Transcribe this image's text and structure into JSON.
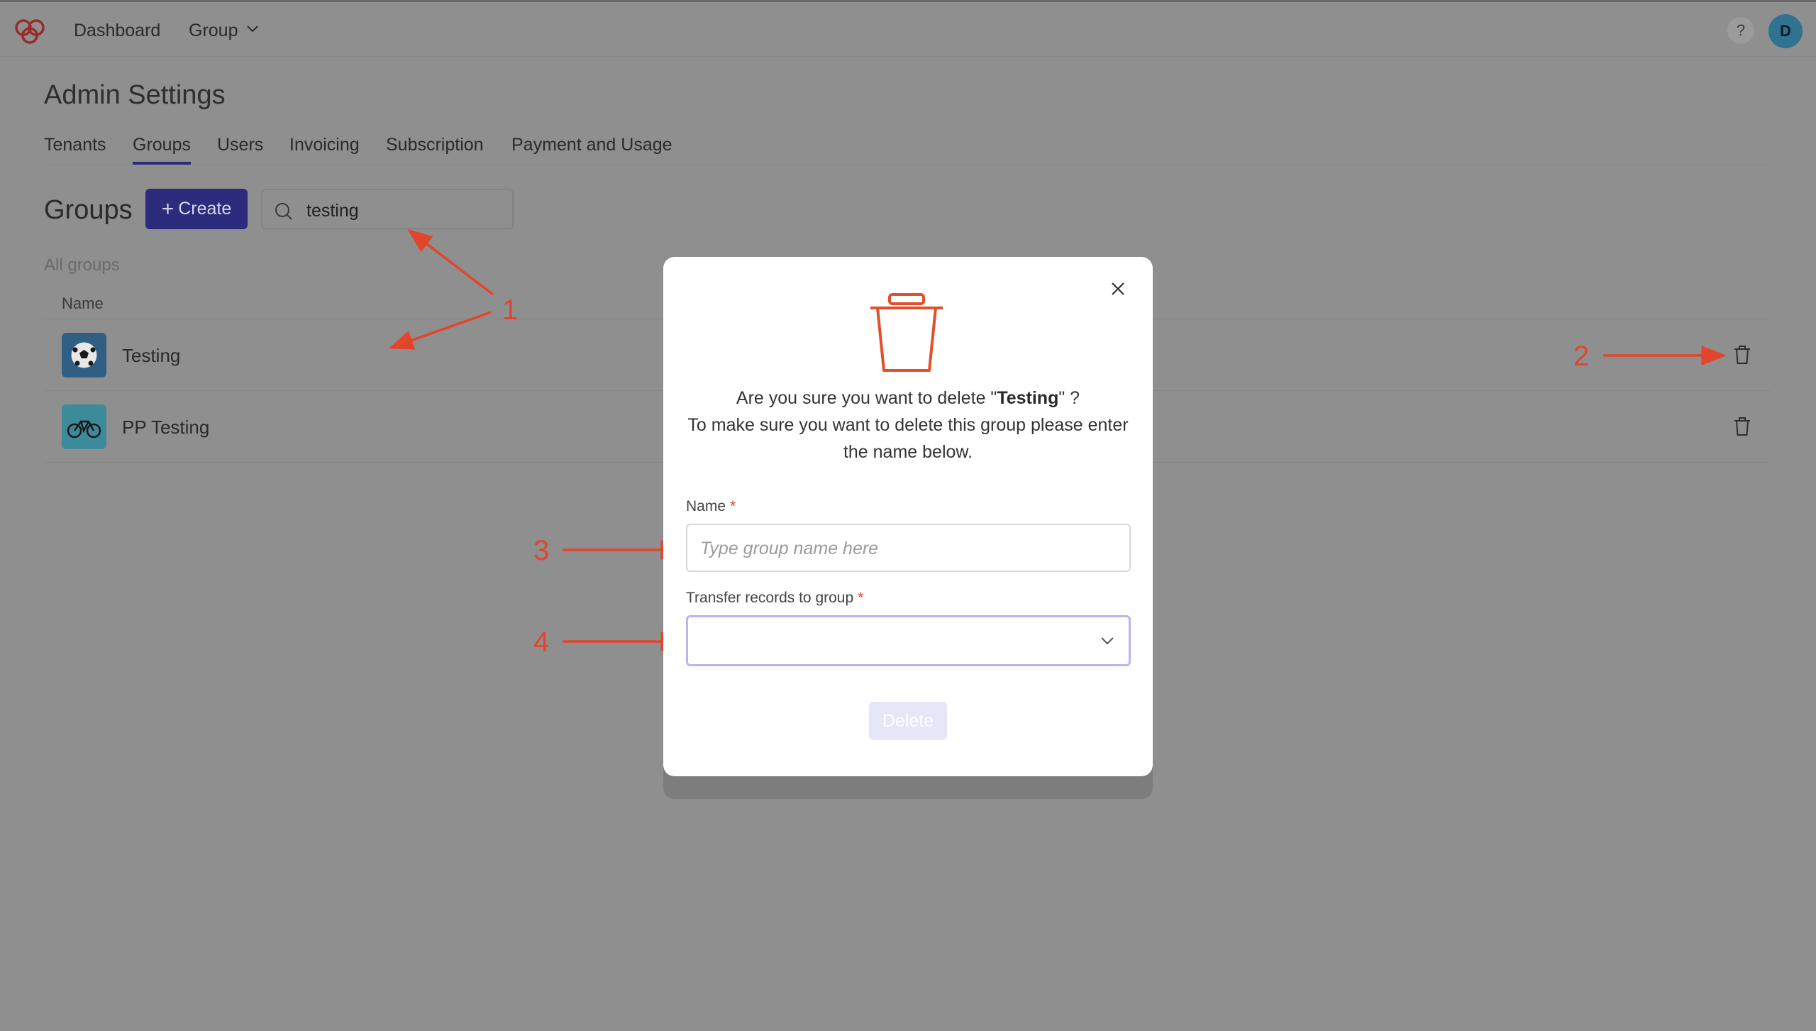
{
  "colors": {
    "overlay": "#8f8f8f",
    "primary": "#2c2b7e",
    "danger": "#e0402e",
    "annotation": "#e2452b",
    "avatar": "#2f7390"
  },
  "topbar": {
    "logo_icon": "hearts-logo-icon",
    "nav": {
      "dashboard": "Dashboard",
      "group": "Group"
    },
    "help_label": "?",
    "avatar_initial": "D"
  },
  "page": {
    "title": "Admin Settings",
    "tabs": [
      "Tenants",
      "Groups",
      "Users",
      "Invoicing",
      "Subscription",
      "Payment and Usage"
    ],
    "active_tab": "Groups"
  },
  "groups": {
    "heading": "Groups",
    "create_label": "Create",
    "search_value": "testing",
    "section_label": "All groups",
    "column_name": "Name",
    "rows": [
      {
        "label": "Testing",
        "icon": "soccer-ball-icon"
      },
      {
        "label": "PP Testing",
        "icon": "bicycle-icon"
      }
    ]
  },
  "annotations": [
    "1",
    "2",
    "3",
    "4"
  ],
  "modal": {
    "question_prefix": "Are you sure you want to delete \"",
    "group_name": "Testing",
    "question_suffix": "\" ?",
    "instruction": "To make sure you want to delete this group please enter the name below.",
    "name_label": "Name",
    "required_mark": "*",
    "name_placeholder": "Type group name here",
    "transfer_label": "Transfer records to group",
    "transfer_value": "",
    "delete_label": "Delete"
  }
}
